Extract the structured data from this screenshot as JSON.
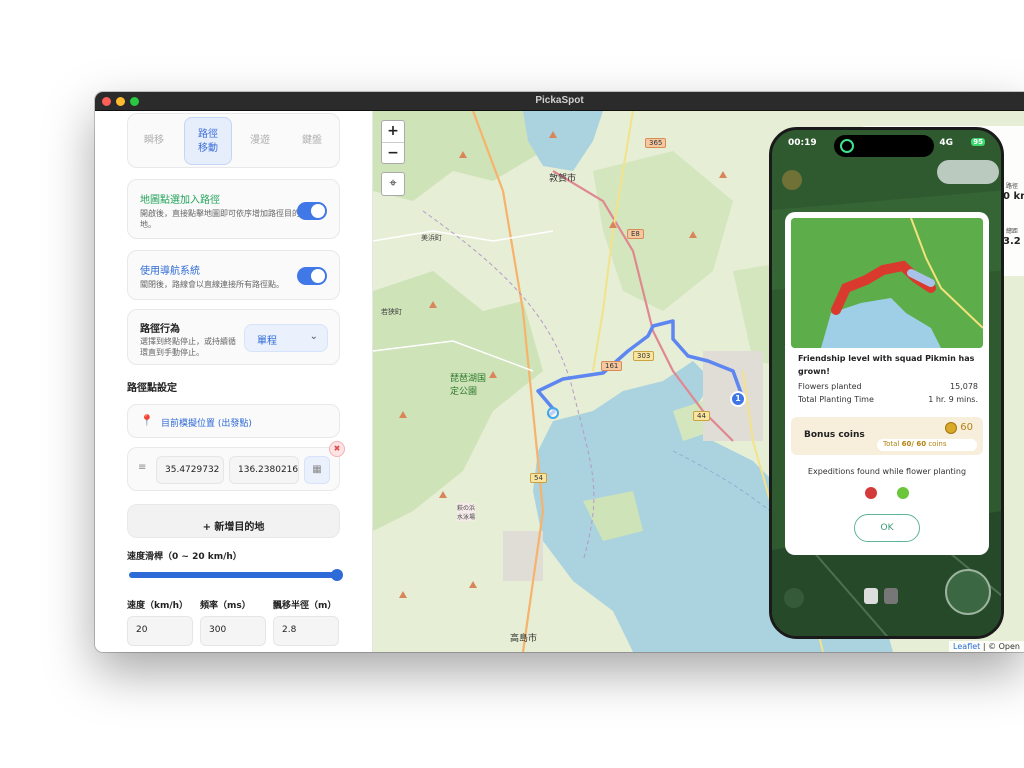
{
  "window": {
    "title": "PickaSpot"
  },
  "sidebar": {
    "modes": [
      {
        "label": "瞬移"
      },
      {
        "label": "路徑\n移動"
      },
      {
        "label": "漫遊"
      },
      {
        "label": "鍵盤"
      }
    ],
    "map_click_toggle": {
      "title": "地圖點選加入路徑",
      "desc": "開啟後，直接點擊地圖即可依序增加路徑目的地。"
    },
    "nav_toggle": {
      "title": "使用導航系統",
      "desc": "關閉後，路線會以直線連接所有路徑點。"
    },
    "route_behavior": {
      "title": "路徑行為",
      "desc": "選擇到終點停止，或持續循環直到手動停止。",
      "select_value": "單程"
    },
    "waypoints": {
      "section_title": "路徑點設定",
      "origin": "目前模擬位置 (出發點)",
      "lat": "35.4729732",
      "lng": "136.2380216",
      "add_button": "+ 新增目的地"
    },
    "speed": {
      "slider_label": "速度滑桿（0 ~ 20 km/h）",
      "slider_fraction": 1.0,
      "speed_label": "速度（km/h）",
      "freq_label": "頻率（ms）",
      "radius_label": "飄移半徑（m）",
      "speed_value": "20",
      "freq_value": "300",
      "radius_value": "2.8"
    }
  },
  "map": {
    "zoom_in": "+",
    "zoom_out": "−",
    "labels": {
      "city1": "敦賀市",
      "city2": "高島市",
      "town1": "美浜町",
      "town2": "若狭町",
      "park": "琵琶湖国\n定公園",
      "beach": "萩の浜\n水泳場",
      "r365": "365",
      "r8": "E8",
      "r161": "161",
      "r303": "303",
      "r54": "54",
      "r44": "44"
    },
    "waypoint_number": "1",
    "attribution_leaflet": "Leaflet",
    "attribution_rest": "| © Open"
  },
  "phone": {
    "time": "00:19",
    "signal": "4G",
    "battery": "95",
    "modal": {
      "title": "Friendship level with squad Pikmin has grown!",
      "flowers_label": "Flowers planted",
      "flowers_value": "15,078",
      "time_label": "Total Planting Time",
      "time_value": "1 hr. 9 mins.",
      "bonus_label": "Bonus coins",
      "bonus_value": "60",
      "total_label": "Total",
      "total_value": "60/ 60",
      "coins_label": "coins",
      "expeditions_label": "Expeditions found while flower planting",
      "ok_label": "OK"
    },
    "right_panel": {
      "t1": "路徑",
      "v1": "0 km",
      "t2": "總距",
      "v2": "3.2 k"
    }
  },
  "colors": {
    "accent": "#4178e8",
    "route": "#5d86f0",
    "water": "#aad3df"
  }
}
